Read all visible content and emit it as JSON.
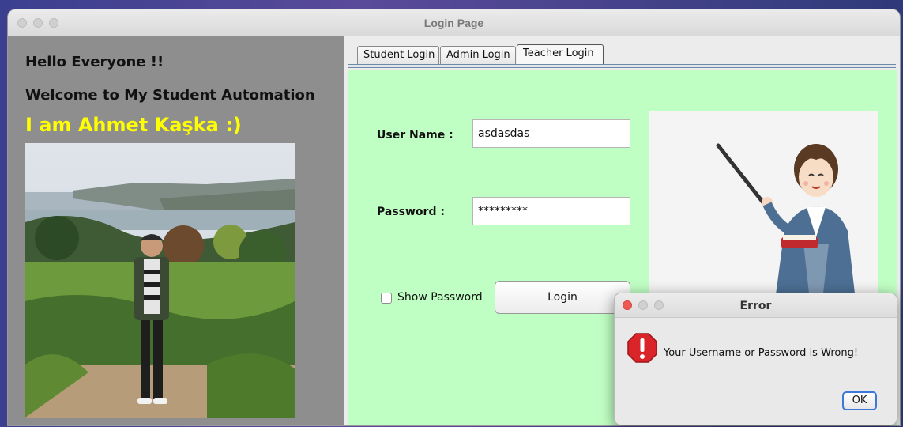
{
  "window": {
    "title": "Login Page"
  },
  "left_panel": {
    "greeting": "Hello Everyone !!",
    "welcome": "Welcome to My Student Automation",
    "name": "I am Ahmet Kaşka :)"
  },
  "tabs": [
    {
      "label": "Student Login",
      "active": false
    },
    {
      "label": "Admin Login",
      "active": false
    },
    {
      "label": "Teacher Login",
      "active": true
    }
  ],
  "form": {
    "username_label": "User Name :",
    "username_value": "asdasdas",
    "password_label": "Password  :",
    "password_value": "*********",
    "show_password_label": "Show Password",
    "show_password_checked": false,
    "login_button": "Login"
  },
  "dialog": {
    "title": "Error",
    "message": "Your Username or Password is Wrong!",
    "ok_button": "OK"
  },
  "colors": {
    "left_panel_bg": "#8e8e8e",
    "name_text": "#ffff00",
    "form_bg": "#c0ffc4",
    "error_icon": "#d9242a"
  },
  "icons": [
    "error-stop-icon",
    "teacher-illustration",
    "profile-photo"
  ]
}
